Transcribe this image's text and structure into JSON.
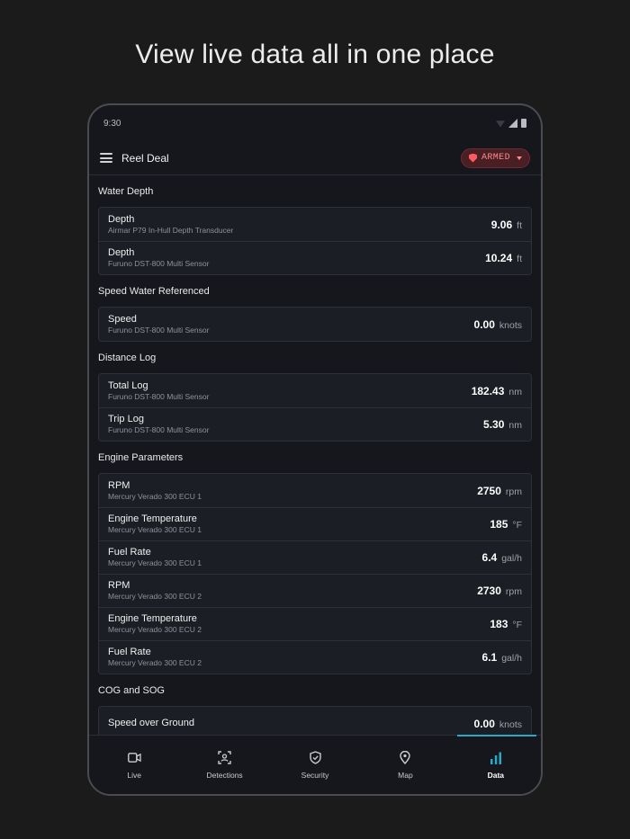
{
  "headline": "View live data all in one place",
  "statusbar": {
    "time": "9:30"
  },
  "appbar": {
    "title": "Reel Deal",
    "armed_label": "ARMED"
  },
  "sections": [
    {
      "title": "Water Depth",
      "rows": [
        {
          "label": "Depth",
          "sub": "Airmar P79 In-Hull Depth Transducer",
          "value": "9.06",
          "unit": "ft"
        },
        {
          "label": "Depth",
          "sub": "Furuno DST-800 Multi Sensor",
          "value": "10.24",
          "unit": "ft"
        }
      ]
    },
    {
      "title": "Speed Water Referenced",
      "rows": [
        {
          "label": "Speed",
          "sub": "Furuno DST-800 Multi Sensor",
          "value": "0.00",
          "unit": "knots"
        }
      ]
    },
    {
      "title": "Distance Log",
      "rows": [
        {
          "label": "Total Log",
          "sub": "Furuno DST-800 Multi Sensor",
          "value": "182.43",
          "unit": "nm"
        },
        {
          "label": "Trip Log",
          "sub": "Furuno DST-800 Multi Sensor",
          "value": "5.30",
          "unit": "nm"
        }
      ]
    },
    {
      "title": "Engine Parameters",
      "rows": [
        {
          "label": "RPM",
          "sub": "Mercury Verado 300 ECU 1",
          "value": "2750",
          "unit": "rpm"
        },
        {
          "label": "Engine Temperature",
          "sub": "Mercury Verado 300 ECU 1",
          "value": "185",
          "unit": "°F"
        },
        {
          "label": "Fuel Rate",
          "sub": "Mercury Verado 300 ECU 1",
          "value": "6.4",
          "unit": "gal/h"
        },
        {
          "label": "RPM",
          "sub": "Mercury Verado 300 ECU 2",
          "value": "2730",
          "unit": "rpm"
        },
        {
          "label": "Engine Temperature",
          "sub": "Mercury Verado 300 ECU 2",
          "value": "183",
          "unit": "°F"
        },
        {
          "label": "Fuel Rate",
          "sub": "Mercury Verado 300 ECU 2",
          "value": "6.1",
          "unit": "gal/h"
        }
      ]
    },
    {
      "title": "COG and SOG",
      "rows": [
        {
          "label": "Speed over Ground",
          "sub": "",
          "value": "0.00",
          "unit": "knots"
        }
      ]
    }
  ],
  "nav": [
    {
      "label": "Live",
      "icon": "video-camera-icon"
    },
    {
      "label": "Detections",
      "icon": "face-detection-icon"
    },
    {
      "label": "Security",
      "icon": "shield-check-icon"
    },
    {
      "label": "Map",
      "icon": "map-pin-icon"
    },
    {
      "label": "Data",
      "icon": "bar-chart-icon",
      "active": true
    }
  ],
  "colors": {
    "accent": "#2ba7c7",
    "armed": "#ff5a63"
  }
}
